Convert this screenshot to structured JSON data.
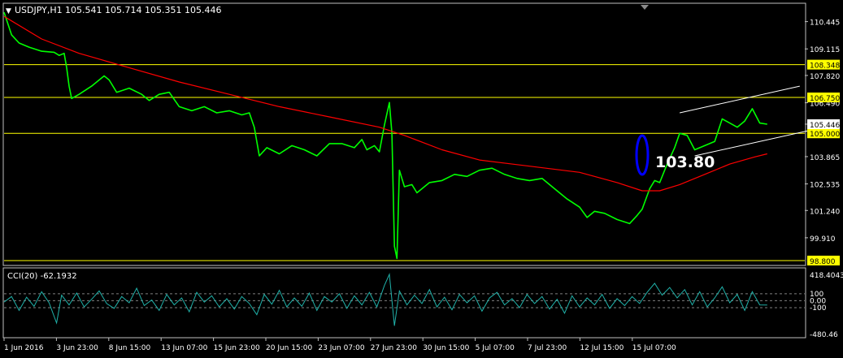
{
  "header": {
    "dropdown_glyph": "▼",
    "symbol": "USDJPY,H1",
    "ohlc": "105.541 105.714 105.351 105.446"
  },
  "colors": {
    "background": "#000000",
    "frame": "#c0c0c0",
    "price_line": "#00ff00",
    "moving_average": "#ff0000",
    "levels": "#ffff00",
    "channel": "#ffffff",
    "ellipse": "#0000ff",
    "cci_line": "#20b2aa",
    "cci_levels": "#808080",
    "text": "#ffffff"
  },
  "chart_data": [
    {
      "type": "line",
      "symbol": "USDJPY",
      "timeframe": "H1",
      "ylim": [
        98.6,
        111.3
      ],
      "y_ticks": [
        "110.445",
        "109.115",
        "107.820",
        "106.490",
        "105.446",
        "103.865",
        "102.535",
        "101.240",
        "99.910"
      ],
      "x_ticks": [
        "1 Jun 2016",
        "3 Jun 23:00",
        "8 Jun 15:00",
        "13 Jun 07:00",
        "15 Jun 23:00",
        "20 Jun 15:00",
        "23 Jun 07:00",
        "27 Jun 23:00",
        "30 Jun 15:00",
        "5 Jul 07:00",
        "7 Jul 23:00",
        "12 Jul 15:00",
        "15 Jul 07:00"
      ],
      "levels": [
        {
          "value": 108.348,
          "label": "108.348"
        },
        {
          "value": 106.75,
          "label": "106.750"
        },
        {
          "value": 105.0,
          "label": "105.000"
        },
        {
          "value": 98.8,
          "label": "98.800"
        }
      ],
      "price_tag": {
        "value": 105.446,
        "label": "105.446"
      },
      "annotation": {
        "text": "103.80",
        "value": 103.8
      },
      "series": [
        {
          "values": [
            [
              0,
              110.9
            ],
            [
              3,
              109.8
            ],
            [
              6,
              109.4
            ],
            [
              10,
              109.2
            ],
            [
              15,
              109.0
            ],
            [
              20,
              108.95
            ],
            [
              22,
              108.8
            ],
            [
              24,
              108.9
            ],
            [
              25,
              108.2
            ],
            [
              26,
              107.3
            ],
            [
              27,
              106.7
            ],
            [
              30,
              106.9
            ],
            [
              35,
              107.3
            ],
            [
              40,
              107.8
            ],
            [
              42,
              107.6
            ],
            [
              45,
              107.0
            ],
            [
              50,
              107.2
            ],
            [
              55,
              106.9
            ],
            [
              58,
              106.6
            ],
            [
              62,
              106.9
            ],
            [
              66,
              107.0
            ],
            [
              70,
              106.3
            ],
            [
              75,
              106.1
            ],
            [
              80,
              106.3
            ],
            [
              85,
              106.0
            ],
            [
              90,
              106.1
            ],
            [
              95,
              105.9
            ],
            [
              98,
              106.0
            ],
            [
              100,
              105.3
            ],
            [
              102,
              103.9
            ],
            [
              105,
              104.3
            ],
            [
              110,
              104.0
            ],
            [
              115,
              104.4
            ],
            [
              120,
              104.2
            ],
            [
              125,
              103.9
            ],
            [
              130,
              104.5
            ],
            [
              135,
              104.5
            ],
            [
              140,
              104.3
            ],
            [
              143,
              104.7
            ],
            [
              145,
              104.2
            ],
            [
              148,
              104.4
            ],
            [
              150,
              104.1
            ],
            [
              152,
              105.4
            ],
            [
              154,
              106.5
            ],
            [
              155,
              105.0
            ],
            [
              156,
              99.5
            ],
            [
              157,
              98.9
            ],
            [
              158,
              103.2
            ],
            [
              160,
              102.4
            ],
            [
              163,
              102.5
            ],
            [
              165,
              102.1
            ],
            [
              170,
              102.6
            ],
            [
              175,
              102.7
            ],
            [
              180,
              103.0
            ],
            [
              185,
              102.9
            ],
            [
              190,
              103.2
            ],
            [
              195,
              103.3
            ],
            [
              200,
              103.0
            ],
            [
              205,
              102.8
            ],
            [
              210,
              102.7
            ],
            [
              215,
              102.8
            ],
            [
              220,
              102.3
            ],
            [
              225,
              101.8
            ],
            [
              230,
              101.4
            ],
            [
              233,
              100.9
            ],
            [
              236,
              101.2
            ],
            [
              240,
              101.1
            ],
            [
              245,
              100.8
            ],
            [
              250,
              100.6
            ],
            [
              253,
              101.0
            ],
            [
              255,
              101.3
            ],
            [
              258,
              102.3
            ],
            [
              260,
              102.7
            ],
            [
              262,
              102.6
            ],
            [
              265,
              103.5
            ],
            [
              268,
              104.3
            ],
            [
              270,
              105.0
            ],
            [
              273,
              104.9
            ],
            [
              276,
              104.2
            ],
            [
              280,
              104.4
            ],
            [
              284,
              104.6
            ],
            [
              287,
              105.7
            ],
            [
              290,
              105.5
            ],
            [
              293,
              105.3
            ],
            [
              296,
              105.6
            ],
            [
              299,
              106.2
            ],
            [
              302,
              105.5
            ],
            [
              305,
              105.446
            ]
          ]
        },
        {
          "values": [
            [
              0,
              110.7
            ],
            [
              15,
              109.6
            ],
            [
              30,
              108.9
            ],
            [
              50,
              108.2
            ],
            [
              70,
              107.5
            ],
            [
              90,
              106.9
            ],
            [
              110,
              106.3
            ],
            [
              130,
              105.8
            ],
            [
              150,
              105.3
            ],
            [
              160,
              104.9
            ],
            [
              175,
              104.2
            ],
            [
              190,
              103.7
            ],
            [
              210,
              103.4
            ],
            [
              230,
              103.1
            ],
            [
              245,
              102.6
            ],
            [
              255,
              102.2
            ],
            [
              262,
              102.2
            ],
            [
              270,
              102.5
            ],
            [
              280,
              103.0
            ],
            [
              290,
              103.5
            ],
            [
              300,
              103.85
            ],
            [
              305,
              104.0
            ]
          ]
        },
        {
          "values": [
            [
              270,
              106.0
            ],
            [
              318,
              107.3
            ]
          ]
        },
        {
          "values": [
            [
              276,
              103.9
            ],
            [
              324,
              105.2
            ]
          ]
        }
      ]
    },
    {
      "type": "line",
      "title": "CCI(20) -62.1932",
      "ylim": [
        -520,
        460
      ],
      "y_ticks": [
        "418.4043",
        "100",
        "0.00",
        "-100",
        "-480.46"
      ],
      "levels": [
        100,
        0,
        -100
      ],
      "series": [
        {
          "values": [
            [
              0,
              -20
            ],
            [
              3,
              60
            ],
            [
              6,
              -140
            ],
            [
              9,
              50
            ],
            [
              12,
              -80
            ],
            [
              15,
              130
            ],
            [
              18,
              -30
            ],
            [
              21,
              -320
            ],
            [
              23,
              80
            ],
            [
              26,
              -60
            ],
            [
              29,
              110
            ],
            [
              32,
              -90
            ],
            [
              35,
              20
            ],
            [
              38,
              140
            ],
            [
              41,
              -40
            ],
            [
              44,
              -110
            ],
            [
              47,
              60
            ],
            [
              50,
              -30
            ],
            [
              53,
              180
            ],
            [
              56,
              -70
            ],
            [
              59,
              10
            ],
            [
              62,
              -140
            ],
            [
              65,
              90
            ],
            [
              68,
              -60
            ],
            [
              71,
              40
            ],
            [
              74,
              -160
            ],
            [
              77,
              120
            ],
            [
              80,
              -20
            ],
            [
              83,
              70
            ],
            [
              86,
              -90
            ],
            [
              89,
              30
            ],
            [
              92,
              -120
            ],
            [
              95,
              60
            ],
            [
              98,
              -40
            ],
            [
              101,
              -200
            ],
            [
              104,
              90
            ],
            [
              107,
              -50
            ],
            [
              110,
              150
            ],
            [
              113,
              -90
            ],
            [
              116,
              40
            ],
            [
              119,
              -80
            ],
            [
              122,
              110
            ],
            [
              125,
              -140
            ],
            [
              128,
              60
            ],
            [
              131,
              -20
            ],
            [
              134,
              100
            ],
            [
              137,
              -110
            ],
            [
              140,
              70
            ],
            [
              143,
              -60
            ],
            [
              146,
              120
            ],
            [
              149,
              -90
            ],
            [
              152,
              220
            ],
            [
              154,
              380
            ],
            [
              156,
              -360
            ],
            [
              158,
              140
            ],
            [
              161,
              -60
            ],
            [
              164,
              80
            ],
            [
              167,
              -40
            ],
            [
              170,
              160
            ],
            [
              173,
              -90
            ],
            [
              176,
              50
            ],
            [
              179,
              -130
            ],
            [
              182,
              90
            ],
            [
              185,
              -30
            ],
            [
              188,
              70
            ],
            [
              191,
              -150
            ],
            [
              194,
              40
            ],
            [
              197,
              120
            ],
            [
              200,
              -60
            ],
            [
              203,
              30
            ],
            [
              206,
              -100
            ],
            [
              209,
              90
            ],
            [
              212,
              -40
            ],
            [
              215,
              60
            ],
            [
              218,
              -120
            ],
            [
              221,
              20
            ],
            [
              224,
              -180
            ],
            [
              227,
              70
            ],
            [
              230,
              -90
            ],
            [
              233,
              40
            ],
            [
              236,
              -60
            ],
            [
              239,
              90
            ],
            [
              242,
              -110
            ],
            [
              245,
              30
            ],
            [
              248,
              -70
            ],
            [
              251,
              60
            ],
            [
              254,
              -40
            ],
            [
              257,
              120
            ],
            [
              260,
              250
            ],
            [
              263,
              80
            ],
            [
              266,
              190
            ],
            [
              269,
              40
            ],
            [
              272,
              160
            ],
            [
              275,
              -60
            ],
            [
              278,
              130
            ],
            [
              281,
              -90
            ],
            [
              284,
              40
            ],
            [
              287,
              200
            ],
            [
              290,
              -30
            ],
            [
              293,
              90
            ],
            [
              296,
              -140
            ],
            [
              299,
              130
            ],
            [
              302,
              -60
            ],
            [
              305,
              -62.19
            ]
          ]
        }
      ]
    }
  ]
}
